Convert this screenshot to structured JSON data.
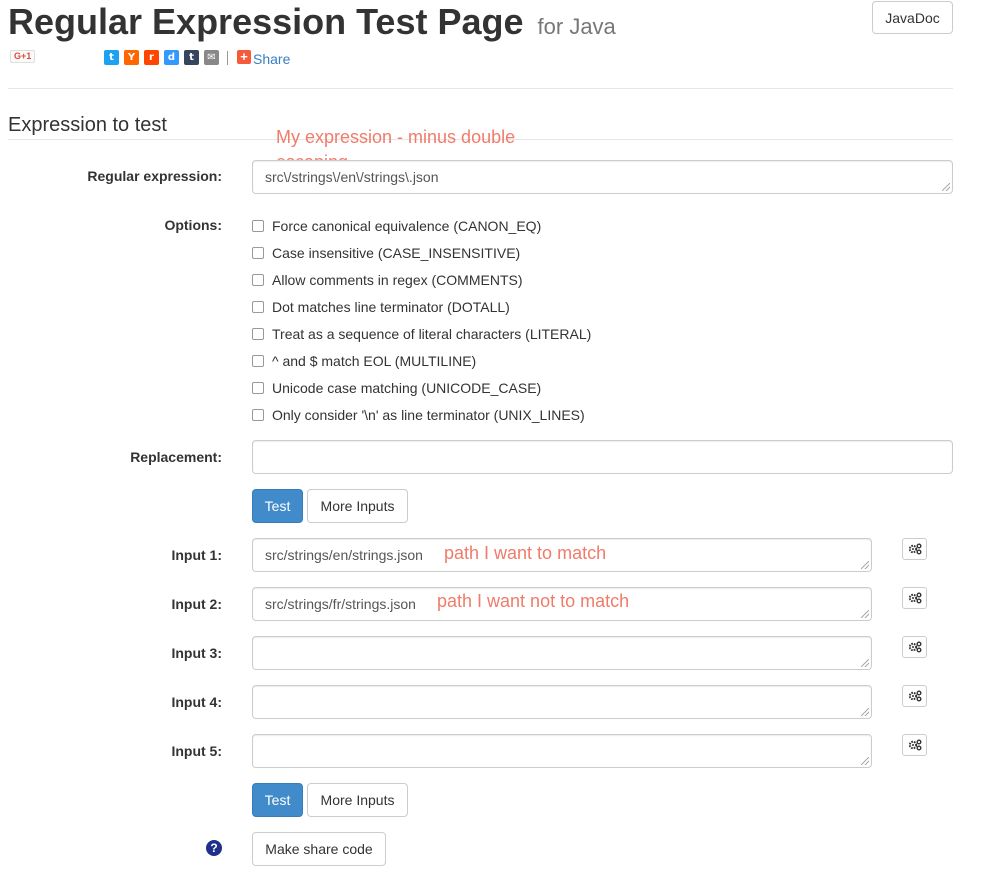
{
  "header": {
    "title": "Regular Expression Test Page",
    "subtitle": "for Java",
    "javadoc_label": "JavaDoc",
    "gplus_label": "G+1",
    "social_icons": [
      {
        "name": "twitter-icon",
        "glyph": "t",
        "color": "#1da1f2"
      },
      {
        "name": "hackernews-icon",
        "glyph": "Y",
        "color": "#ff6600"
      },
      {
        "name": "reddit-icon",
        "glyph": "r",
        "color": "#ff4500"
      },
      {
        "name": "delicious-icon",
        "glyph": "d",
        "color": "#3399ff"
      },
      {
        "name": "tumblr-icon",
        "glyph": "t",
        "color": "#35465c"
      },
      {
        "name": "email-icon",
        "glyph": "✉",
        "color": "#888888"
      }
    ],
    "share_label": "Share"
  },
  "section": {
    "heading": "Expression to test"
  },
  "form": {
    "regex_label": "Regular expression:",
    "regex_value": "src\\/strings\\/en\\/strings\\.json",
    "options_label": "Options:",
    "options": [
      "Force canonical equivalence (CANON_EQ)",
      "Case insensitive (CASE_INSENSITIVE)",
      "Allow comments in regex (COMMENTS)",
      "Dot matches line terminator (DOTALL)",
      "Treat as a sequence of literal characters (LITERAL)",
      "^ and $ match EOL (MULTILINE)",
      "Unicode case matching (UNICODE_CASE)",
      "Only consider '\\n' as line terminator (UNIX_LINES)"
    ],
    "replacement_label": "Replacement:",
    "replacement_value": "",
    "test_label": "Test",
    "more_inputs_label": "More Inputs",
    "inputs": [
      {
        "label": "Input 1:",
        "value": "src/strings/en/strings.json",
        "annotation": "path I want to match"
      },
      {
        "label": "Input 2:",
        "value": "src/strings/fr/strings.json",
        "annotation": "path I want not to match"
      },
      {
        "label": "Input 3:",
        "value": "",
        "annotation": ""
      },
      {
        "label": "Input 4:",
        "value": "",
        "annotation": ""
      },
      {
        "label": "Input 5:",
        "value": "",
        "annotation": ""
      }
    ],
    "share_code_label": "Make share code",
    "help_glyph": "?"
  },
  "annotations": {
    "expression_note": "My expression - minus double escaping"
  },
  "colors": {
    "primary_button": "#428bca",
    "annotation": "#f07b6a",
    "share_link": "#3a7dc0"
  }
}
